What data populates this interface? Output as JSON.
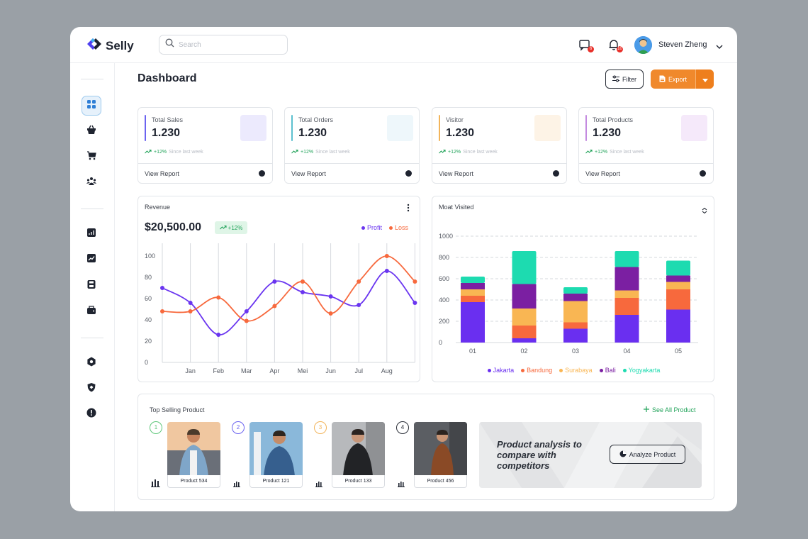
{
  "app": {
    "name": "Selly"
  },
  "search": {
    "placeholder": "Search"
  },
  "header": {
    "notifications": [
      {
        "icon": "message-icon",
        "count": "6"
      },
      {
        "icon": "bell-icon",
        "count": "10"
      }
    ],
    "user": {
      "name": "Steven Zheng"
    }
  },
  "page": {
    "title": "Dashboard",
    "filter_label": "Filter",
    "export_label": "Export"
  },
  "stats": [
    {
      "label": "Total Sales",
      "value": "1.230",
      "trend": "+12%",
      "since": "Since last week",
      "link": "View Report",
      "accent": "#6b63f0",
      "swatch": "#eceafd"
    },
    {
      "label": "Total Orders",
      "value": "1.230",
      "trend": "+12%",
      "since": "Since last week",
      "link": "View Report",
      "accent": "#5cc0cf",
      "swatch": "#eef7fb"
    },
    {
      "label": "Visitor",
      "value": "1.230",
      "trend": "+12%",
      "since": "Since last week",
      "link": "View Report",
      "accent": "#f2b45a",
      "swatch": "#fdf3e6"
    },
    {
      "label": "Total Products",
      "value": "1.230",
      "trend": "+12%",
      "since": "Since last week",
      "link": "View Report",
      "accent": "#c48be0",
      "swatch": "#f5e9fa"
    }
  ],
  "revenue": {
    "title": "Revenue",
    "amount": "$20,500.00",
    "badge": "+12%",
    "legend": {
      "profit": "Profit",
      "loss": "Loss"
    }
  },
  "visits": {
    "title": "Moat Visited"
  },
  "top_products": {
    "title": "Top Selling Product",
    "see_all": "See All Product",
    "items": [
      {
        "rank": "1",
        "name": "Product 534",
        "rank_color": "#5fc77b"
      },
      {
        "rank": "2",
        "name": "Product 121",
        "rank_color": "#6b63f0"
      },
      {
        "rank": "3",
        "name": "Product 133",
        "rank_color": "#f2b45a"
      },
      {
        "rank": "4",
        "name": "Product 456",
        "rank_color": "#2a2f38"
      }
    ],
    "analysis_text": "Product analysis to compare with competitors",
    "analyze_button": "Analyze Product"
  },
  "colors": {
    "accent": "#f0892c",
    "profit": "#6a35f0",
    "loss": "#f7693d",
    "positive": "#22a35a"
  },
  "sidebar": {
    "icons": [
      "grid-icon",
      "basket-icon",
      "cart-icon",
      "users-icon",
      "report-icon",
      "trend-icon",
      "save-icon",
      "wallet-icon",
      "settings-icon",
      "shield-icon",
      "info-icon"
    ]
  },
  "chart_data": [
    {
      "type": "line",
      "title": "",
      "categories": [
        "Jan",
        "Feb",
        "Mar",
        "Apr",
        "Mei",
        "Jun",
        "Jul",
        "Aug"
      ],
      "x_points": [
        "start",
        "Jan",
        "Feb",
        "Mar",
        "Apr",
        "Mei",
        "Jun",
        "Jul",
        "Aug",
        "end"
      ],
      "series": [
        {
          "name": "Profit",
          "color": "#6a35f0",
          "values": [
            70,
            56,
            26,
            48,
            76,
            66,
            62,
            54,
            86,
            56
          ]
        },
        {
          "name": "Loss",
          "color": "#f7693d",
          "values": [
            48,
            48,
            61,
            39,
            53,
            76,
            46,
            76,
            100,
            76
          ]
        }
      ],
      "ylim": [
        0,
        100
      ],
      "yticks": [
        0,
        20,
        40,
        60,
        80,
        100
      ],
      "grid": "vertical",
      "legend": "top-right"
    },
    {
      "type": "bar",
      "stacked": true,
      "title": "",
      "categories": [
        "01",
        "02",
        "03",
        "04",
        "05"
      ],
      "series": [
        {
          "name": "Jakarta",
          "color": "#6a2ff0",
          "values": [
            380,
            40,
            130,
            260,
            310
          ]
        },
        {
          "name": "Bandung",
          "color": "#f7693d",
          "values": [
            60,
            120,
            60,
            160,
            190
          ]
        },
        {
          "name": "Surabaya",
          "color": "#f9b653",
          "values": [
            60,
            160,
            200,
            70,
            70
          ]
        },
        {
          "name": "Bali",
          "color": "#7b1fa2",
          "values": [
            60,
            230,
            70,
            220,
            60
          ]
        },
        {
          "name": "Yogyakarta",
          "color": "#1ddbb0",
          "values": [
            60,
            310,
            60,
            150,
            140
          ]
        }
      ],
      "ylim": [
        0,
        1000
      ],
      "yticks": [
        0,
        200,
        400,
        600,
        800,
        1000
      ],
      "grid": "horizontal-dashed",
      "legend": "bottom"
    }
  ]
}
